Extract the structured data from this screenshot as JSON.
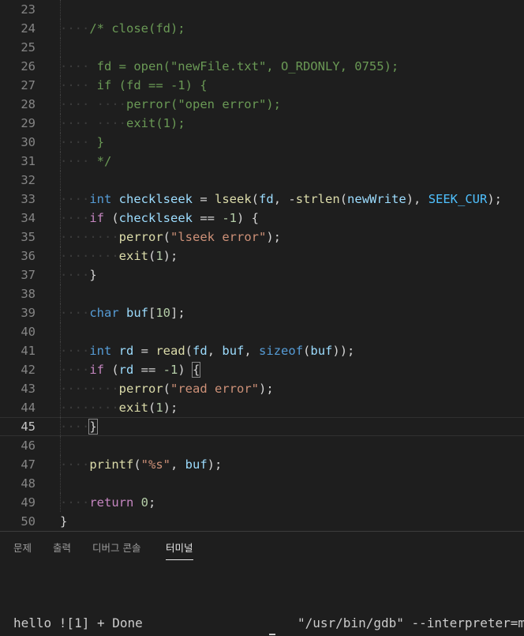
{
  "editor": {
    "lines": [
      {
        "n": "23",
        "tokens": []
      },
      {
        "n": "24",
        "tokens": [
          [
            "ws",
            "····"
          ],
          [
            "cmt",
            "/* close(fd);"
          ]
        ]
      },
      {
        "n": "25",
        "tokens": []
      },
      {
        "n": "26",
        "tokens": [
          [
            "ws",
            "····"
          ],
          [
            "cmt",
            " fd = open(\"newFile.txt\", O_RDONLY, 0755);"
          ]
        ]
      },
      {
        "n": "27",
        "tokens": [
          [
            "ws",
            "····"
          ],
          [
            "cmt",
            " if (fd == -1) {"
          ]
        ]
      },
      {
        "n": "28",
        "tokens": [
          [
            "ws",
            "····"
          ],
          [
            "cmt",
            " "
          ],
          [
            "ws",
            "····"
          ],
          [
            "cmt",
            "perror(\"open error\");"
          ]
        ]
      },
      {
        "n": "29",
        "tokens": [
          [
            "ws",
            "····"
          ],
          [
            "cmt",
            " "
          ],
          [
            "ws",
            "····"
          ],
          [
            "cmt",
            "exit(1);"
          ]
        ]
      },
      {
        "n": "30",
        "tokens": [
          [
            "ws",
            "····"
          ],
          [
            "cmt",
            " }"
          ]
        ]
      },
      {
        "n": "31",
        "tokens": [
          [
            "ws",
            "····"
          ],
          [
            "cmt",
            " */"
          ]
        ]
      },
      {
        "n": "32",
        "tokens": []
      },
      {
        "n": "33",
        "tokens": [
          [
            "ws",
            "····"
          ],
          [
            "kw",
            "int"
          ],
          [
            "pun",
            " "
          ],
          [
            "var",
            "checklseek"
          ],
          [
            "pun",
            " = "
          ],
          [
            "fn",
            "lseek"
          ],
          [
            "pun",
            "("
          ],
          [
            "var",
            "fd"
          ],
          [
            "pun",
            ", -"
          ],
          [
            "fn",
            "strlen"
          ],
          [
            "pun",
            "("
          ],
          [
            "var",
            "newWrite"
          ],
          [
            "pun",
            "), "
          ],
          [
            "mac",
            "SEEK_CUR"
          ],
          [
            "pun",
            ");"
          ]
        ]
      },
      {
        "n": "34",
        "tokens": [
          [
            "ws",
            "····"
          ],
          [
            "ctl",
            "if"
          ],
          [
            "pun",
            " ("
          ],
          [
            "var",
            "checklseek"
          ],
          [
            "pun",
            " == "
          ],
          [
            "num",
            "-1"
          ],
          [
            "pun",
            ") {"
          ]
        ]
      },
      {
        "n": "35",
        "tokens": [
          [
            "ws",
            "········"
          ],
          [
            "fn",
            "perror"
          ],
          [
            "pun",
            "("
          ],
          [
            "str",
            "\"lseek error\""
          ],
          [
            "pun",
            ");"
          ]
        ]
      },
      {
        "n": "36",
        "tokens": [
          [
            "ws",
            "········"
          ],
          [
            "fn",
            "exit"
          ],
          [
            "pun",
            "("
          ],
          [
            "num",
            "1"
          ],
          [
            "pun",
            ");"
          ]
        ]
      },
      {
        "n": "37",
        "tokens": [
          [
            "ws",
            "····"
          ],
          [
            "pun",
            "}"
          ]
        ]
      },
      {
        "n": "38",
        "tokens": []
      },
      {
        "n": "39",
        "tokens": [
          [
            "ws",
            "····"
          ],
          [
            "kw",
            "char"
          ],
          [
            "pun",
            " "
          ],
          [
            "var",
            "buf"
          ],
          [
            "pun",
            "["
          ],
          [
            "num",
            "10"
          ],
          [
            "pun",
            "];"
          ]
        ]
      },
      {
        "n": "40",
        "tokens": []
      },
      {
        "n": "41",
        "tokens": [
          [
            "ws",
            "····"
          ],
          [
            "kw",
            "int"
          ],
          [
            "pun",
            " "
          ],
          [
            "var",
            "rd"
          ],
          [
            "pun",
            " = "
          ],
          [
            "fn",
            "read"
          ],
          [
            "pun",
            "("
          ],
          [
            "var",
            "fd"
          ],
          [
            "pun",
            ", "
          ],
          [
            "var",
            "buf"
          ],
          [
            "pun",
            ", "
          ],
          [
            "kw",
            "sizeof"
          ],
          [
            "pun",
            "("
          ],
          [
            "var",
            "buf"
          ],
          [
            "pun",
            "));"
          ]
        ]
      },
      {
        "n": "42",
        "tokens": [
          [
            "ws",
            "····"
          ],
          [
            "ctl",
            "if"
          ],
          [
            "pun",
            " ("
          ],
          [
            "var",
            "rd"
          ],
          [
            "pun",
            " == "
          ],
          [
            "num",
            "-1"
          ],
          [
            "pun",
            ") "
          ],
          [
            "bm",
            "{"
          ]
        ]
      },
      {
        "n": "43",
        "tokens": [
          [
            "ws",
            "········"
          ],
          [
            "fn",
            "perror"
          ],
          [
            "pun",
            "("
          ],
          [
            "str",
            "\"read error\""
          ],
          [
            "pun",
            ");"
          ]
        ]
      },
      {
        "n": "44",
        "tokens": [
          [
            "ws",
            "········"
          ],
          [
            "fn",
            "exit"
          ],
          [
            "pun",
            "("
          ],
          [
            "num",
            "1"
          ],
          [
            "pun",
            ");"
          ]
        ]
      },
      {
        "n": "45",
        "tokens": [
          [
            "ws",
            "····"
          ],
          [
            "bm",
            "}"
          ]
        ],
        "current": true
      },
      {
        "n": "46",
        "tokens": []
      },
      {
        "n": "47",
        "tokens": [
          [
            "ws",
            "····"
          ],
          [
            "fn",
            "printf"
          ],
          [
            "pun",
            "("
          ],
          [
            "str",
            "\"%s\""
          ],
          [
            "pun",
            ", "
          ],
          [
            "var",
            "buf"
          ],
          [
            "pun",
            ");"
          ]
        ]
      },
      {
        "n": "48",
        "tokens": []
      },
      {
        "n": "49",
        "tokens": [
          [
            "ws",
            "····"
          ],
          [
            "ctl",
            "return"
          ],
          [
            "pun",
            " "
          ],
          [
            "num",
            "0"
          ],
          [
            "pun",
            ";"
          ]
        ]
      },
      {
        "n": "50",
        "tokens": [
          [
            "pun",
            "}"
          ]
        ]
      }
    ]
  },
  "panel": {
    "tabs": [
      {
        "label": "문제",
        "active": false
      },
      {
        "label": "출력",
        "active": false
      },
      {
        "label": "디버그 콘솔",
        "active": false
      },
      {
        "label": "터미널",
        "active": true
      }
    ],
    "terminal_left": "hello ![1] + Done",
    "terminal_right": "\"/usr/bin/gdb\" --interpreter=mi"
  }
}
